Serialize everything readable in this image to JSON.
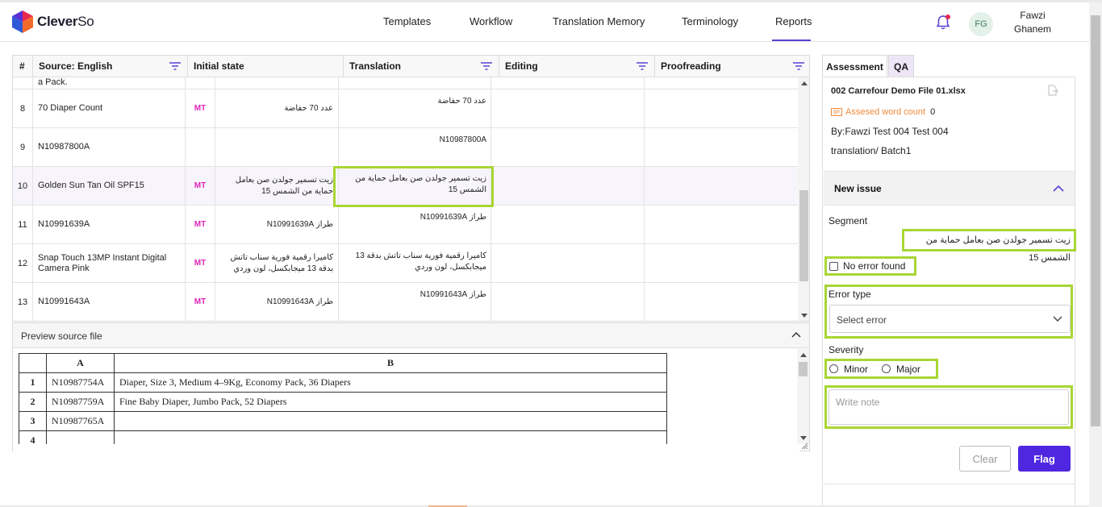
{
  "app": {
    "logo_left": "Clever",
    "logo_right": "So"
  },
  "nav": {
    "items": [
      {
        "label": "Templates"
      },
      {
        "label": "Workflow"
      },
      {
        "label": "Translation Memory"
      },
      {
        "label": "Terminology"
      },
      {
        "label": "Reports"
      }
    ],
    "active": "Reports"
  },
  "user": {
    "initials": "FG",
    "first_name": "Fawzi",
    "last_name": "Ghanem"
  },
  "grid": {
    "columns": [
      "#",
      "Source: English",
      "Initial state",
      "Translation",
      "Editing",
      "Proofreading"
    ],
    "partial_top_text": "a Pack.",
    "rows": [
      {
        "num": "8",
        "source": "70 Diaper Count",
        "state": "MT",
        "initial": "عدد 70 حفاضة",
        "translation": "عدد 70 حفاضة"
      },
      {
        "num": "9",
        "source": "N10987800A",
        "state": "",
        "initial": "",
        "translation": "N10987800A"
      },
      {
        "num": "10",
        "source": "Golden Sun Tan Oil SPF15",
        "state": "MT",
        "initial": "زيت تسمير جولدن صن بعامل حماية من الشمس 15",
        "translation": "زيت تسمير جولدن صن بعامل حماية من الشمس 15"
      },
      {
        "num": "11",
        "source": "N10991639A",
        "state": "MT",
        "initial": "طراز N10991639A",
        "translation": "طراز N10991639A"
      },
      {
        "num": "12",
        "source": "Snap Touch 13MP Instant Digital Camera Pink",
        "state": "MT",
        "initial": "كاميرا رقمية فورية سناب تاتش بدقة 13 ميجابكسل، لون وردي",
        "translation": "كاميرا رقمية فورية سناب تاتش بدقة 13 ميجابكسل، لون وردي"
      },
      {
        "num": "13",
        "source": "N10991643A",
        "state": "MT",
        "initial": "طراز N10991643A",
        "translation": "طراز N10991643A"
      }
    ]
  },
  "preview": {
    "title": "Preview source file",
    "col_a": "A",
    "col_b": "B",
    "rows": [
      {
        "n": "1",
        "a": "N10987754A",
        "b": "Diaper, Size 3, Medium 4–9Kg, Economy Pack, 36 Diapers"
      },
      {
        "n": "2",
        "a": "N10987759A",
        "b": "Fine Baby Diaper, Jumbo Pack, 52 Diapers"
      },
      {
        "n": "3",
        "a": "N10987765A",
        "b": ""
      },
      {
        "n": "4",
        "a": "",
        "b": ""
      }
    ]
  },
  "panel": {
    "tabs": [
      "Assessment",
      "QA"
    ],
    "file_name": "002 Carrefour Demo File 01.xlsx",
    "word_count_label": "Assesed word count",
    "word_count_value": "0",
    "by": "By:Fawzi Test 004 Test 004",
    "batch": "translation/ Batch1",
    "new_issue": "New issue",
    "segment_label": "Segment",
    "segment_value": "زيت تسمير جولدن صن بعامل حماية من الشمس 15",
    "no_error_label": "No error found",
    "error_type_label": "Error type",
    "error_select_value": "Select error",
    "severity_label": "Severity",
    "severity_options": [
      "Minor",
      "Major"
    ],
    "note_placeholder": "Write note",
    "clear_label": "Clear",
    "flag_label": "Flag"
  },
  "colors": {
    "accent": "#4f27e0",
    "highlight": "#a8d633",
    "mt_tag": "#e026b8",
    "word_count": "#f08a3a"
  }
}
